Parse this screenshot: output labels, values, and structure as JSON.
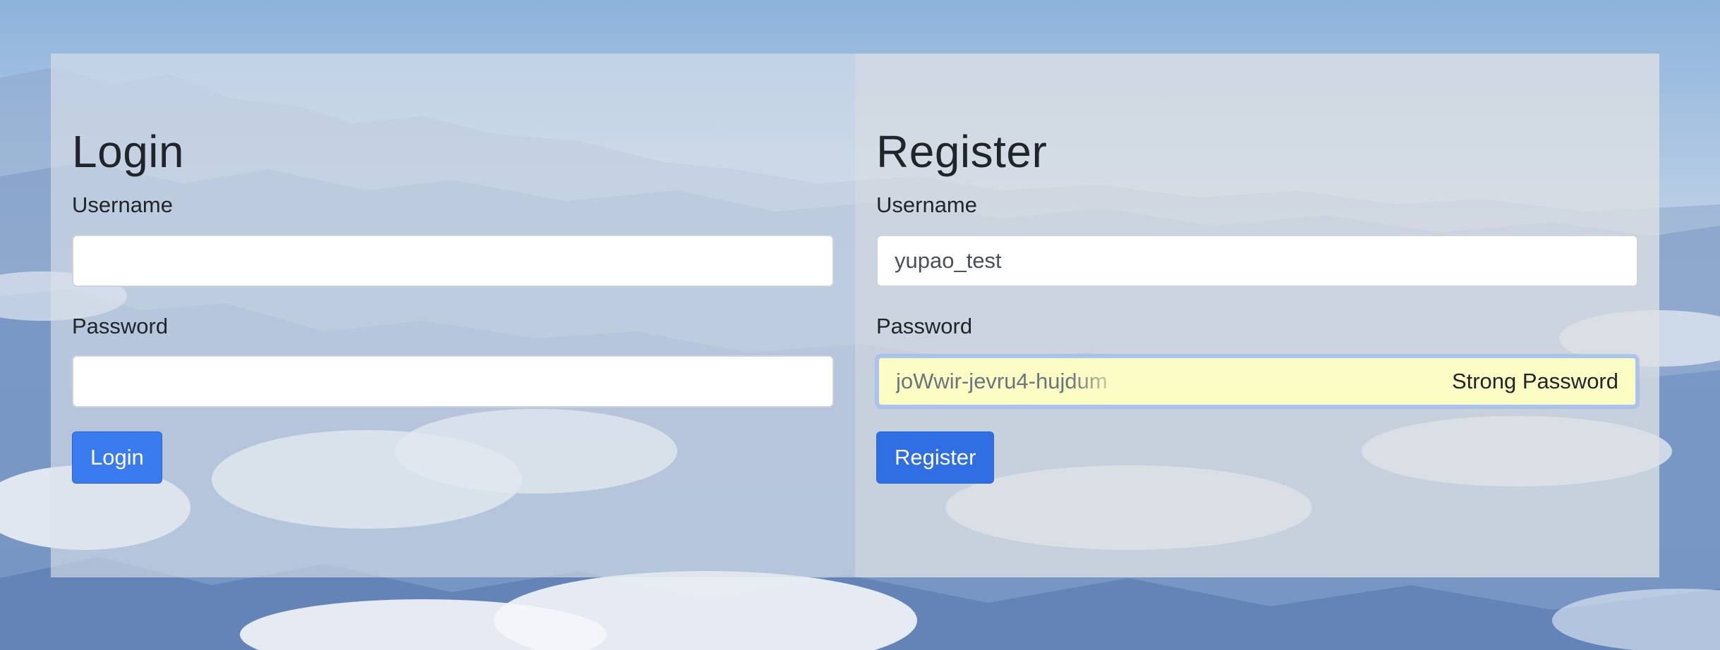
{
  "login": {
    "title": "Login",
    "username_label": "Username",
    "username_value": "",
    "password_label": "Password",
    "password_value": "",
    "button_label": "Login"
  },
  "register": {
    "title": "Register",
    "username_label": "Username",
    "username_value": "yupao_test",
    "password_label": "Password",
    "password_value": "joWwir-jevru4-hujdum",
    "password_hint": "Strong Password",
    "button_label": "Register"
  },
  "colors": {
    "primary_button": "#2f6fe3",
    "autofill_background": "#fbfdc4",
    "focus_ring": "#a9c4f0"
  }
}
